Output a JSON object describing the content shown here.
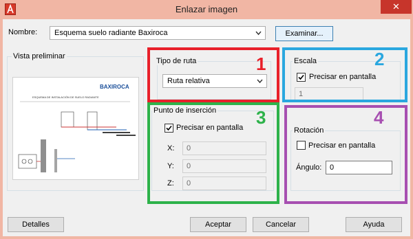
{
  "window": {
    "title": "Enlazar imagen",
    "close_symbol": "✕"
  },
  "nombre": {
    "label": "Nombre:",
    "value": "Esquema suelo radiante Baxiroca",
    "browse_button": "Examinar..."
  },
  "preview": {
    "group_title": "Vista preliminar",
    "brand_text": "BAXIROCA",
    "heading_text": "ESQUEMA DE INSTALACIÓN DE SUELO RADIANTE"
  },
  "ruta": {
    "group_title": "Tipo de ruta",
    "value": "Ruta relativa"
  },
  "escala": {
    "group_title": "Escala",
    "checkbox_label": "Precisar en pantalla",
    "checked": true,
    "value": "1"
  },
  "insercion": {
    "group_title": "Punto de inserción",
    "checkbox_label": "Precisar en pantalla",
    "checked": true,
    "x_label": "X:",
    "x_value": "0",
    "y_label": "Y:",
    "y_value": "0",
    "z_label": "Z:",
    "z_value": "0"
  },
  "rotacion": {
    "group_title": "Rotación",
    "checkbox_label": "Precisar en pantalla",
    "checked": false,
    "angle_label": "Ángulo:",
    "angle_value": "0"
  },
  "buttons": {
    "details": "Detalles",
    "accept": "Aceptar",
    "cancel": "Cancelar",
    "help": "Ayuda"
  },
  "annotations": {
    "n1": "1",
    "n2": "2",
    "n3": "3",
    "n4": "4",
    "color_1": "#e8202a",
    "color_2": "#2aa7df",
    "color_3": "#2db24a",
    "color_4": "#a74fb1"
  }
}
